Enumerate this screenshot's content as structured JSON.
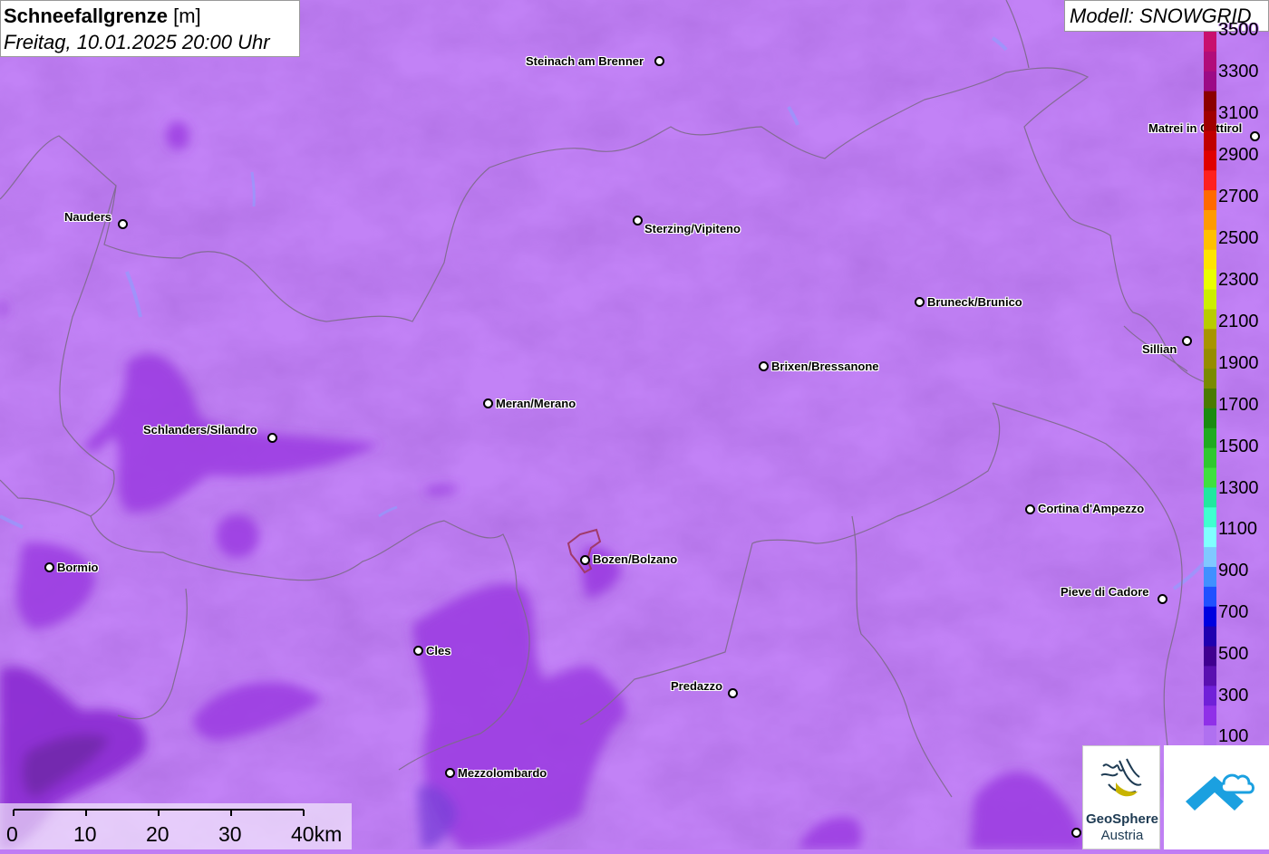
{
  "header": {
    "title_bold": "Schneefallgrenze",
    "title_unit": "[m]",
    "datetime": "Freitag, 10.01.2025 20:00 Uhr"
  },
  "model": {
    "label": "Modell: SNOWGRID"
  },
  "cities": [
    {
      "name": "Steinach am Brenner"
    },
    {
      "name": "Nauders"
    },
    {
      "name": "Sterzing/Vipiteno"
    },
    {
      "name": "Matrei in Osttirol"
    },
    {
      "name": "Bruneck/Brunico"
    },
    {
      "name": "Sillian"
    },
    {
      "name": "Brixen/Bressanone"
    },
    {
      "name": "Meran/Merano"
    },
    {
      "name": "Schlanders/Silandro"
    },
    {
      "name": "Cortina d'Ampezzo"
    },
    {
      "name": "Bormio"
    },
    {
      "name": "Bozen/Bolzano"
    },
    {
      "name": "Pieve di Cadore"
    },
    {
      "name": "Cles"
    },
    {
      "name": "Predazzo"
    },
    {
      "name": "Mezzolombardo"
    }
  ],
  "legend": {
    "labels": [
      "3500",
      "3300",
      "3100",
      "2900",
      "2700",
      "2500",
      "2300",
      "2100",
      "1900",
      "1700",
      "1500",
      "1300",
      "1100",
      "900",
      "700",
      "500",
      "300",
      "100"
    ],
    "colors": [
      "#c8106e",
      "#b10c7a",
      "#9c0a86",
      "#8b0000",
      "#a00000",
      "#c00000",
      "#e00000",
      "#ff2020",
      "#ff6a00",
      "#ff9a00",
      "#ffc000",
      "#ffe400",
      "#eaff00",
      "#ccee00",
      "#b8cc00",
      "#a89400",
      "#968c00",
      "#7a8a00",
      "#4a7a00",
      "#1a8a10",
      "#20aa20",
      "#30c830",
      "#40e040",
      "#20e8a0",
      "#40ffd0",
      "#80ffff",
      "#80c8ff",
      "#4090ff",
      "#2050ff",
      "#0000e0",
      "#2000b0",
      "#400090",
      "#5a10b0",
      "#7020d8",
      "#9030e8",
      "#b070f0"
    ],
    "color_count": 36
  },
  "scalebar": {
    "labels": [
      "0",
      "10",
      "20",
      "30",
      "40km"
    ]
  },
  "logos": {
    "geosphere_line1": "GeoSphere",
    "geosphere_line2": "Austria"
  }
}
